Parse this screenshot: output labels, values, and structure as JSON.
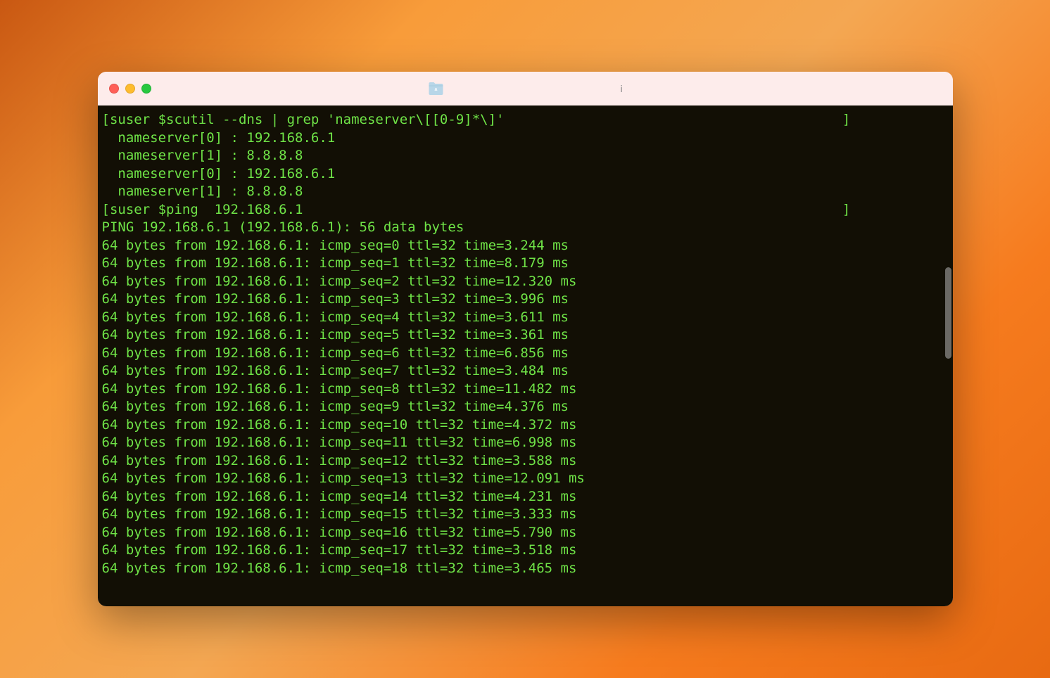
{
  "titlebar": {
    "title": "i"
  },
  "terminal": {
    "lines": [
      "[suser $scutil --dns | grep 'nameserver\\[[0-9]*\\]'",
      "  nameserver[0] : 192.168.6.1",
      "  nameserver[1] : 8.8.8.8",
      "  nameserver[0] : 192.168.6.1",
      "  nameserver[1] : 8.8.8.8",
      "[suser $ping  192.168.6.1",
      "",
      "PING 192.168.6.1 (192.168.6.1): 56 data bytes",
      "64 bytes from 192.168.6.1: icmp_seq=0 ttl=32 time=3.244 ms",
      "64 bytes from 192.168.6.1: icmp_seq=1 ttl=32 time=8.179 ms",
      "64 bytes from 192.168.6.1: icmp_seq=2 ttl=32 time=12.320 ms",
      "64 bytes from 192.168.6.1: icmp_seq=3 ttl=32 time=3.996 ms",
      "64 bytes from 192.168.6.1: icmp_seq=4 ttl=32 time=3.611 ms",
      "64 bytes from 192.168.6.1: icmp_seq=5 ttl=32 time=3.361 ms",
      "64 bytes from 192.168.6.1: icmp_seq=6 ttl=32 time=6.856 ms",
      "64 bytes from 192.168.6.1: icmp_seq=7 ttl=32 time=3.484 ms",
      "64 bytes from 192.168.6.1: icmp_seq=8 ttl=32 time=11.482 ms",
      "64 bytes from 192.168.6.1: icmp_seq=9 ttl=32 time=4.376 ms",
      "64 bytes from 192.168.6.1: icmp_seq=10 ttl=32 time=4.372 ms",
      "64 bytes from 192.168.6.1: icmp_seq=11 ttl=32 time=6.998 ms",
      "64 bytes from 192.168.6.1: icmp_seq=12 ttl=32 time=3.588 ms",
      "64 bytes from 192.168.6.1: icmp_seq=13 ttl=32 time=12.091 ms",
      "64 bytes from 192.168.6.1: icmp_seq=14 ttl=32 time=4.231 ms",
      "64 bytes from 192.168.6.1: icmp_seq=15 ttl=32 time=3.333 ms",
      "64 bytes from 192.168.6.1: icmp_seq=16 ttl=32 time=5.790 ms",
      "64 bytes from 192.168.6.1: icmp_seq=17 ttl=32 time=3.518 ms",
      "64 bytes from 192.168.6.1: icmp_seq=18 ttl=32 time=3.465 ms"
    ],
    "line0_suffix_bracket": "]",
    "line5_suffix_bracket": "]"
  }
}
